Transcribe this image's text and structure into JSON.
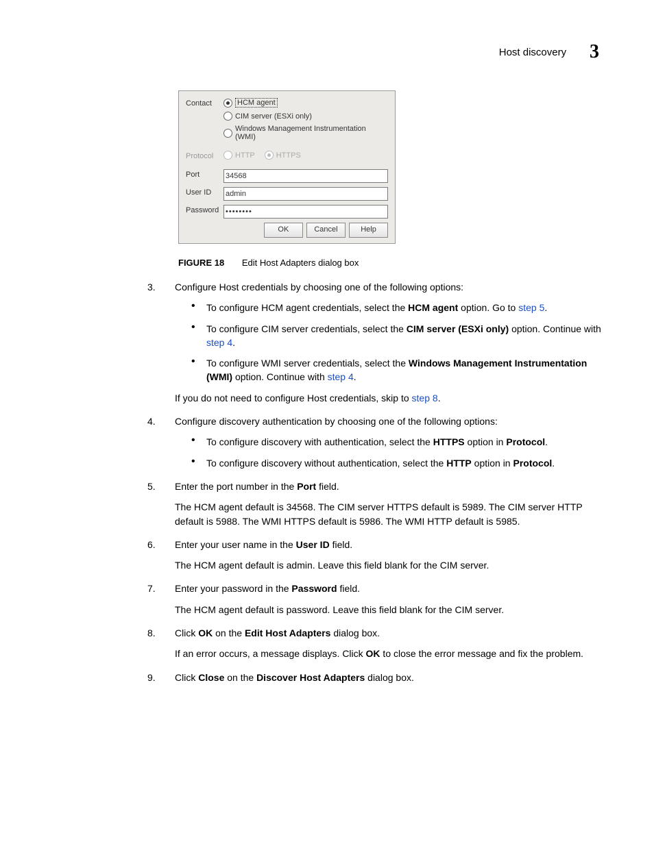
{
  "header": {
    "title": "Host discovery",
    "chapter": "3"
  },
  "dialog": {
    "contact_label": "Contact",
    "contact_options": {
      "hcm": "HCM agent",
      "cim": "CIM server (ESXi only)",
      "wmi": "Windows Management Instrumentation (WMI)"
    },
    "protocol_label": "Protocol",
    "protocol_options": {
      "http": "HTTP",
      "https": "HTTPS"
    },
    "port_label": "Port",
    "port_value": "34568",
    "user_label": "User ID",
    "user_value": "admin",
    "password_label": "Password",
    "password_value": "••••••••",
    "buttons": {
      "ok": "OK",
      "cancel": "Cancel",
      "help": "Help"
    }
  },
  "figure": {
    "label": "FIGURE 18",
    "caption": "Edit Host Adapters dialog box"
  },
  "steps": {
    "s3": {
      "num": "3.",
      "text": "Configure Host credentials by choosing one of the following options:",
      "b1a": "To configure HCM agent credentials, select the ",
      "b1b": "HCM agent",
      "b1c": " option. Go to ",
      "b1d": "step 5",
      "b1e": ".",
      "b2a": "To configure CIM server credentials, select the ",
      "b2b": "CIM server (ESXi only)",
      "b2c": " option. Continue with ",
      "b2d": "step 4",
      "b2e": ".",
      "b3a": "To configure WMI server credentials, select the ",
      "b3b": "Windows Management Instrumentation (WMI)",
      "b3c": " option. Continue with ",
      "b3d": "step 4",
      "b3e": ".",
      "after_a": "If you do not need to configure Host credentials, skip to ",
      "after_b": "step 8",
      "after_c": "."
    },
    "s4": {
      "num": "4.",
      "text": "Configure discovery authentication by choosing one of the following options:",
      "b1a": "To configure discovery with authentication, select the ",
      "b1b": "HTTPS",
      "b1c": " option in ",
      "b1d": "Protocol",
      "b1e": ".",
      "b2a": "To configure discovery without authentication, select the ",
      "b2b": "HTTP",
      "b2c": " option in ",
      "b2d": "Protocol",
      "b2e": "."
    },
    "s5": {
      "num": "5.",
      "text_a": "Enter the port number in the ",
      "text_b": "Port",
      "text_c": " field.",
      "para": "The HCM agent default is 34568. The CIM server HTTPS default is 5989. The CIM server HTTP default is 5988. The WMI HTTPS default is 5986. The WMI HTTP default is 5985."
    },
    "s6": {
      "num": "6.",
      "text_a": "Enter your user name in the ",
      "text_b": "User ID",
      "text_c": " field.",
      "para": "The HCM agent default is admin. Leave this field blank for the CIM server."
    },
    "s7": {
      "num": "7.",
      "text_a": "Enter your password in the ",
      "text_b": "Password",
      "text_c": " field.",
      "para": "The HCM agent default is password. Leave this field blank for the CIM server."
    },
    "s8": {
      "num": "8.",
      "text_a": "Click ",
      "text_b": "OK",
      "text_c": " on the ",
      "text_d": "Edit Host Adapters",
      "text_e": " dialog box.",
      "para_a": "If an error occurs, a message displays. Click ",
      "para_b": "OK",
      "para_c": " to close the error message and fix the problem."
    },
    "s9": {
      "num": "9.",
      "text_a": "Click ",
      "text_b": "Close",
      "text_c": " on the ",
      "text_d": "Discover Host Adapters",
      "text_e": " dialog box."
    }
  }
}
